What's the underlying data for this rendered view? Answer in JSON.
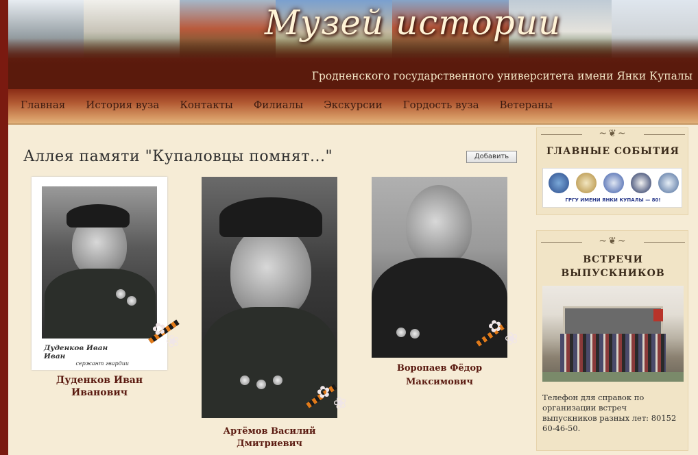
{
  "header": {
    "title": "Музей истории",
    "subtitle": "Гродненского государственного университета имени Янки Купалы"
  },
  "nav": {
    "items": [
      {
        "label": "Главная"
      },
      {
        "label": "История вуза"
      },
      {
        "label": "Контакты"
      },
      {
        "label": "Филиалы"
      },
      {
        "label": "Экскурсии"
      },
      {
        "label": "Гордость вуза"
      },
      {
        "label": "Ветераны"
      }
    ]
  },
  "main": {
    "title": "Аллея памяти \"Купаловцы помнят...\"",
    "add_button": "Добавить",
    "cards": [
      {
        "name_line1": "Дуденков Иван",
        "name_line2": "Иванович",
        "photo_caption_1": "Дуденков Иван Иван",
        "photo_caption_2": "сержант гвардии"
      },
      {
        "name_line1": "Артёмов Василий",
        "name_line2": "Дмитриевич"
      },
      {
        "name_line1": "Воропаев Фёдор",
        "name_line2": "Максимович"
      }
    ]
  },
  "sidebar": {
    "events_heading": "ГЛАВНЫЕ СОБЫТИЯ",
    "events_banner_text": "ГРГУ ИМЕНИ ЯНКИ КУПАЛЫ — 80!",
    "alumni_heading_1": "ВСТРЕЧИ",
    "alumni_heading_2": "ВЫПУСКНИКОВ",
    "alumni_text": "Телефон для справок по организации встреч выпускников разных лет: 80152 60-46-50."
  }
}
